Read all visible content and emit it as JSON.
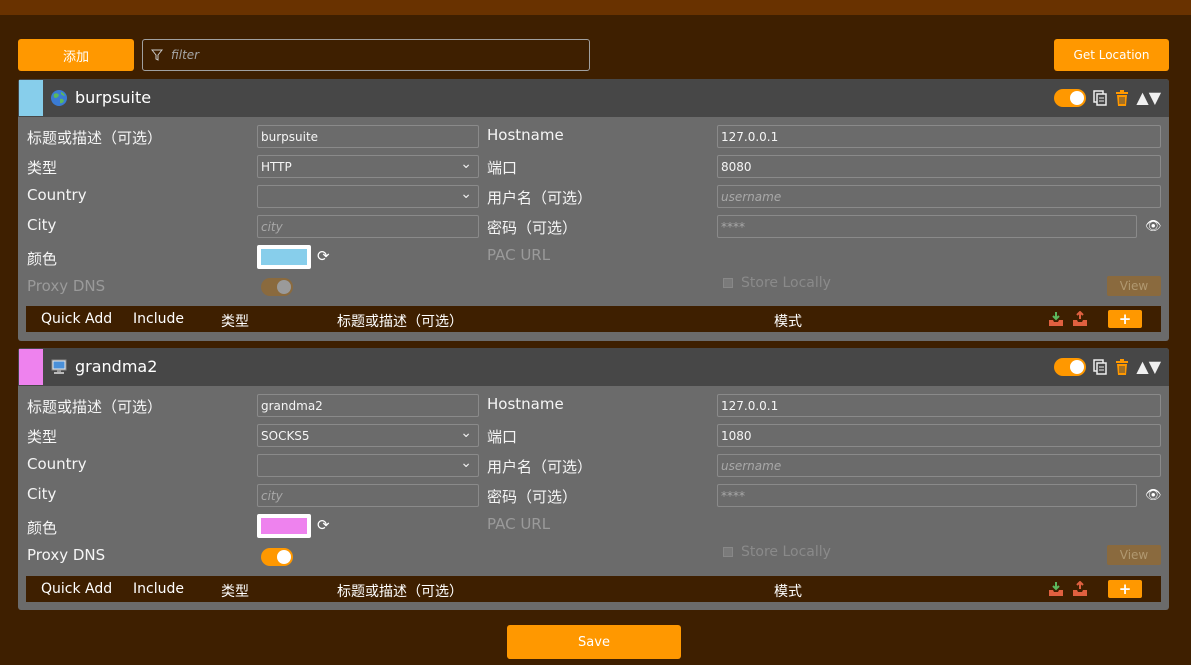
{
  "toolbar": {
    "add_label": "添加",
    "filter_placeholder": "filter",
    "get_location_label": "Get Location"
  },
  "labels": {
    "title": "标题或描述（可选）",
    "type": "类型",
    "country": "Country",
    "city": "City",
    "color": "颜色",
    "proxy_dns": "Proxy DNS",
    "hostname": "Hostname",
    "port": "端口",
    "username": "用户名（可选）",
    "password": "密码（可选）",
    "pac_url": "PAC URL",
    "store_locally": "Store Locally",
    "view": "View",
    "city_placeholder": "city",
    "username_placeholder": "username",
    "password_mask": "****"
  },
  "pattern_bar": {
    "quick_add": "Quick Add",
    "include": "Include",
    "type": "类型",
    "title": "标题或描述（可选）",
    "pattern": "模式",
    "plus": "+"
  },
  "proxies": [
    {
      "title": "burpsuite",
      "type": "HTTP",
      "country": "",
      "hostname": "127.0.0.1",
      "port": "8080",
      "color": "#87ceeb",
      "icon": "globe-icon",
      "enabled": true,
      "proxy_dns": false
    },
    {
      "title": "grandma2",
      "type": "SOCKS5",
      "country": "",
      "hostname": "127.0.0.1",
      "port": "1080",
      "color": "#ee82ee",
      "icon": "computer-icon",
      "enabled": true,
      "proxy_dns": true
    }
  ],
  "save_label": "Save"
}
